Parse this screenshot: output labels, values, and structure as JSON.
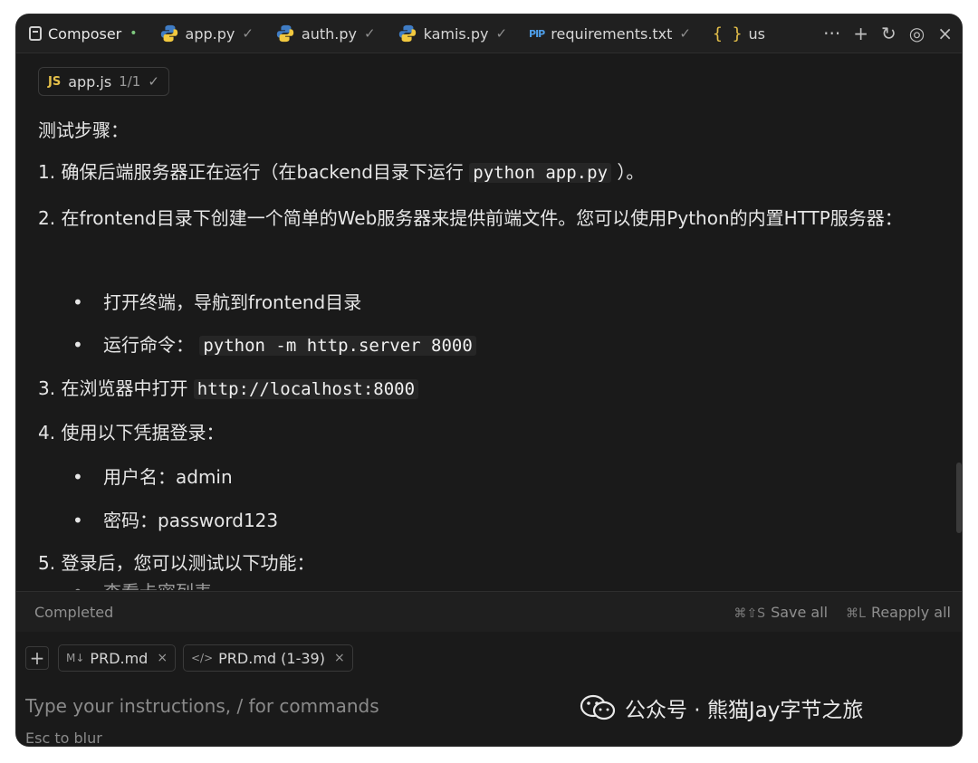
{
  "tabs": [
    {
      "label": "Composer",
      "status": "•",
      "icon": "composer-icon"
    },
    {
      "label": "app.py",
      "status": "✓",
      "icon": "python-icon"
    },
    {
      "label": "auth.py",
      "status": "✓",
      "icon": "python-icon"
    },
    {
      "label": "kamis.py",
      "status": "✓",
      "icon": "python-icon"
    },
    {
      "label": "requirements.txt",
      "status": "✓",
      "icon": "pip-icon"
    },
    {
      "label": "us",
      "status": "",
      "icon": "json-braces-icon"
    }
  ],
  "tab_actions": {
    "more": "···",
    "add": "+",
    "history": "↻",
    "settings": "◎",
    "close": "×"
  },
  "file_chip": {
    "badge": "JS",
    "name": "app.js",
    "count": "1/1",
    "status": "✓"
  },
  "content": {
    "heading": "测试步骤：",
    "step1_prefix": "1. 确保后端服务器正在运行（在backend目录下运行 ",
    "step1_code": "python app.py",
    "step1_suffix": " ）。",
    "step2": "2. 在frontend目录下创建一个简单的Web服务器来提供前端文件。您可以使用Python的内置HTTP服务器：",
    "step2_b1": "打开终端，导航到frontend目录",
    "step2_b2_prefix": "运行命令： ",
    "step2_b2_code": "python -m http.server 8000",
    "step3_prefix": "3. 在浏览器中打开 ",
    "step3_code": "http://localhost:8000",
    "step4": "4. 使用以下凭据登录：",
    "step4_b1": "用户名：admin",
    "step4_b2": "密码：password123",
    "step5": "5. 登录后，您可以测试以下功能：",
    "step5_b1_partial": "查看卡密列表",
    "bullet": "•"
  },
  "status": {
    "state": "Completed",
    "save_kbd": "⌘⇧S",
    "save_label": "Save all",
    "reapply_kbd": "⌘L",
    "reapply_label": "Reapply all"
  },
  "input": {
    "add": "+",
    "chips": [
      {
        "icon": "M↓",
        "label": "PRD.md",
        "close": "×"
      },
      {
        "icon": "</>",
        "label": "PRD.md (1-39)",
        "close": "×"
      }
    ],
    "placeholder": "Type your instructions, / for commands",
    "hint": "Esc to blur"
  },
  "watermark": {
    "text": "公众号 · 熊猫Jay字节之旅"
  }
}
